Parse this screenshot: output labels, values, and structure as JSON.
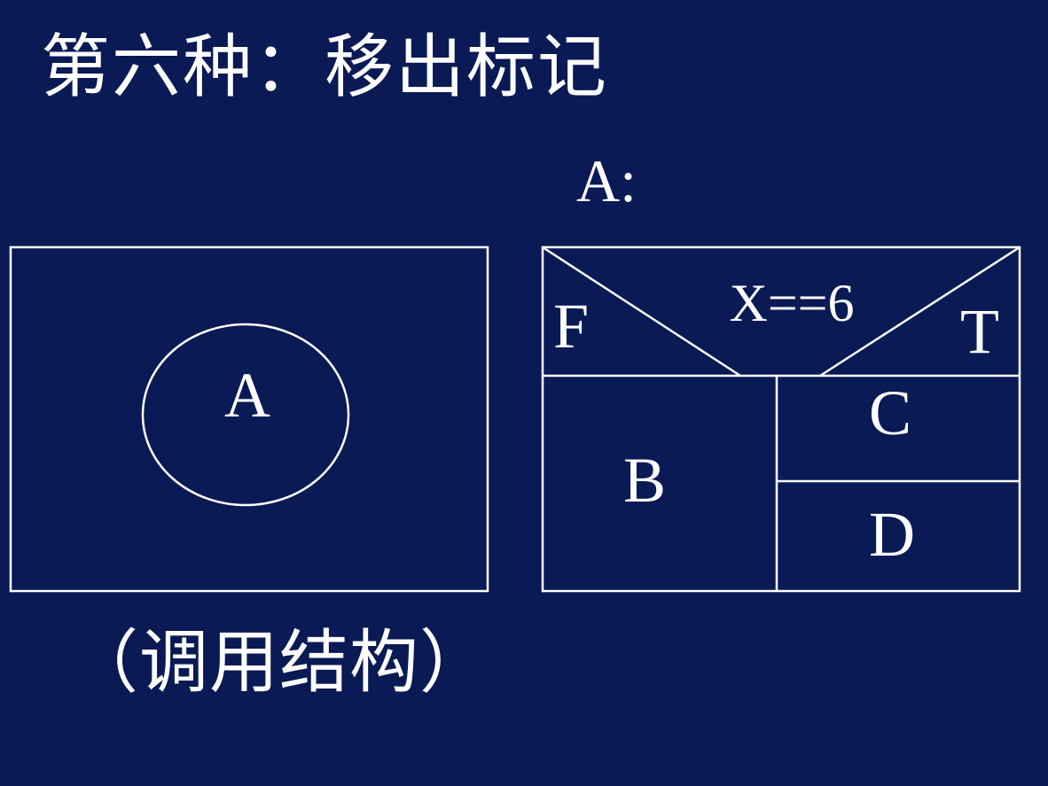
{
  "slide": {
    "title": "第六种：移出标记",
    "caption": "（调用结构）",
    "sublabel": "A:"
  },
  "call_structure": {
    "module_label": "A"
  },
  "nassi_shneiderman": {
    "condition": "X==6",
    "false_label": "F",
    "true_label": "T",
    "false_branch": "B",
    "true_branch_1": "C",
    "true_branch_2": "D"
  },
  "colors": {
    "background": "#0a1a55",
    "foreground": "#ffffff"
  }
}
